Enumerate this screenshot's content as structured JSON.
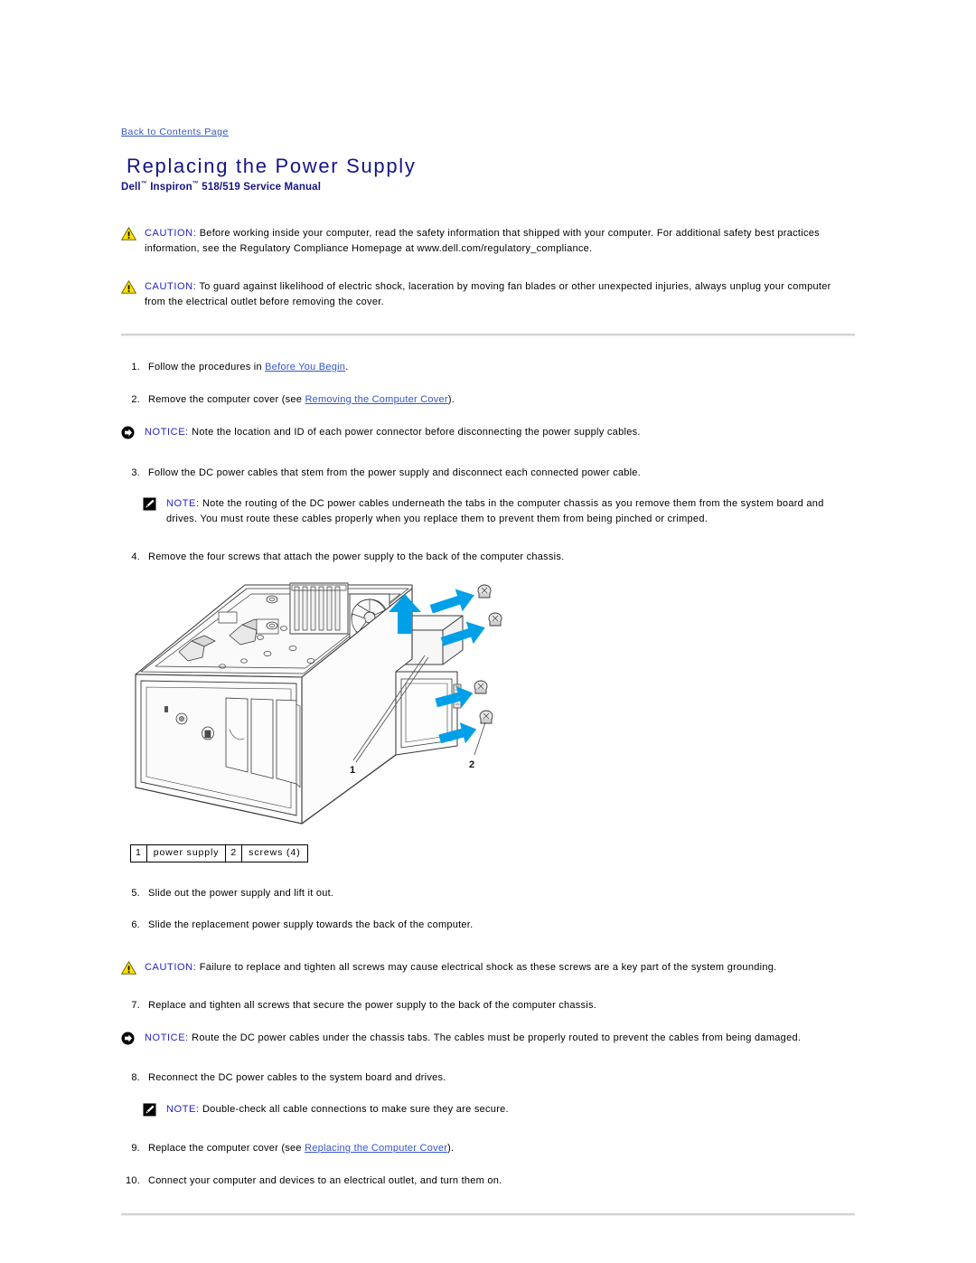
{
  "document": {
    "back_link": "Back to Contents Page",
    "title": "Replacing the Power Supply",
    "subtitle_brand": "Dell",
    "subtitle_tm1": "™",
    "subtitle_product": " Inspiron",
    "subtitle_tm2": "™",
    "subtitle_rest": " 518/519 Service Manual"
  },
  "colors": {
    "title_navy": "#151585",
    "link_blue": "#3355cc",
    "admon_label_blue": "#2222cc",
    "caution_yellow": "#FFE000",
    "arrow_blue": "#00A0E8",
    "rule_gray": "#d2d2d2"
  },
  "admonitions": {
    "caution_1": {
      "icon": "warning-triangle-icon",
      "label": "CAUTION:",
      "text": " Before working inside your computer, read the safety information that shipped with your computer. For additional safety best practices information, see the Regulatory Compliance Homepage at www.dell.com/regulatory_compliance."
    },
    "caution_2": {
      "icon": "warning-triangle-icon",
      "label": "CAUTION:",
      "text": " To guard against likelihood of electric shock, laceration by moving fan blades or other unexpected injuries, always unplug your computer from the electrical outlet before removing the cover."
    },
    "notice_1": {
      "icon": "notice-arrow-icon",
      "label": "NOTICE:",
      "text": " Note the location and ID of each power connector before disconnecting the power supply cables."
    },
    "note_1": {
      "icon": "note-pencil-icon",
      "label": "NOTE:",
      "text": " Note the routing of the DC power cables underneath the tabs in the computer chassis as you remove them from the system board and drives. You must route these cables properly when you replace them to prevent them from being pinched or crimped."
    },
    "caution_3": {
      "icon": "warning-triangle-icon",
      "label": "CAUTION:",
      "text": " Failure to replace and tighten all screws may cause electrical shock as these screws are a key part of the system grounding."
    },
    "notice_2": {
      "icon": "notice-arrow-icon",
      "label": "NOTICE:",
      "text": " Route the DC power cables under the chassis tabs. The cables must be properly routed to prevent the cables from being damaged."
    },
    "note_2": {
      "icon": "note-pencil-icon",
      "label": "NOTE:",
      "text": " Double-check all cable connections to make sure they are secure."
    }
  },
  "steps": {
    "s1": {
      "num": "1.",
      "pre": "Follow the procedures in ",
      "link": "Before You Begin",
      "post": "."
    },
    "s2": {
      "num": "2.",
      "pre": "Remove the computer cover (see ",
      "link": "Removing the Computer Cover",
      "post": ")."
    },
    "s3": {
      "num": "3.",
      "pre": "Follow the DC power cables that stem from the power supply and disconnect each connected power cable.",
      "link": "",
      "post": ""
    },
    "s4": {
      "num": "4.",
      "pre": "Remove the four screws that attach the power supply to the back of the computer chassis.",
      "link": "",
      "post": ""
    },
    "s5": {
      "num": "5.",
      "pre": "Slide out the power supply and lift it out.",
      "link": "",
      "post": ""
    },
    "s6": {
      "num": "6.",
      "pre": "Slide the replacement power supply towards the back of the computer.",
      "link": "",
      "post": ""
    },
    "s7": {
      "num": "7.",
      "pre": "Replace and tighten all screws that secure the power supply to the back of the computer chassis.",
      "link": "",
      "post": ""
    },
    "s8": {
      "num": "8.",
      "pre": "Reconnect the DC power cables to the system board and drives.",
      "link": "",
      "post": ""
    },
    "s9": {
      "num": "9.",
      "pre": "Replace the computer cover (see ",
      "link": "Replacing the Computer Cover",
      "post": ")."
    },
    "s10": {
      "num": "10.",
      "pre": "Connect your computer and devices to an electrical outlet, and turn them on.",
      "link": "",
      "post": ""
    }
  },
  "figure": {
    "alt": "Isometric line drawing of the computer chassis on its side with four screws being removed from the rear panel and a blue arrow showing the power supply lifting out",
    "callout_1": "1",
    "callout_2": "2",
    "legend": [
      {
        "index": "1",
        "label": "power supply"
      },
      {
        "index": "2",
        "label": "screws (4)"
      }
    ]
  }
}
